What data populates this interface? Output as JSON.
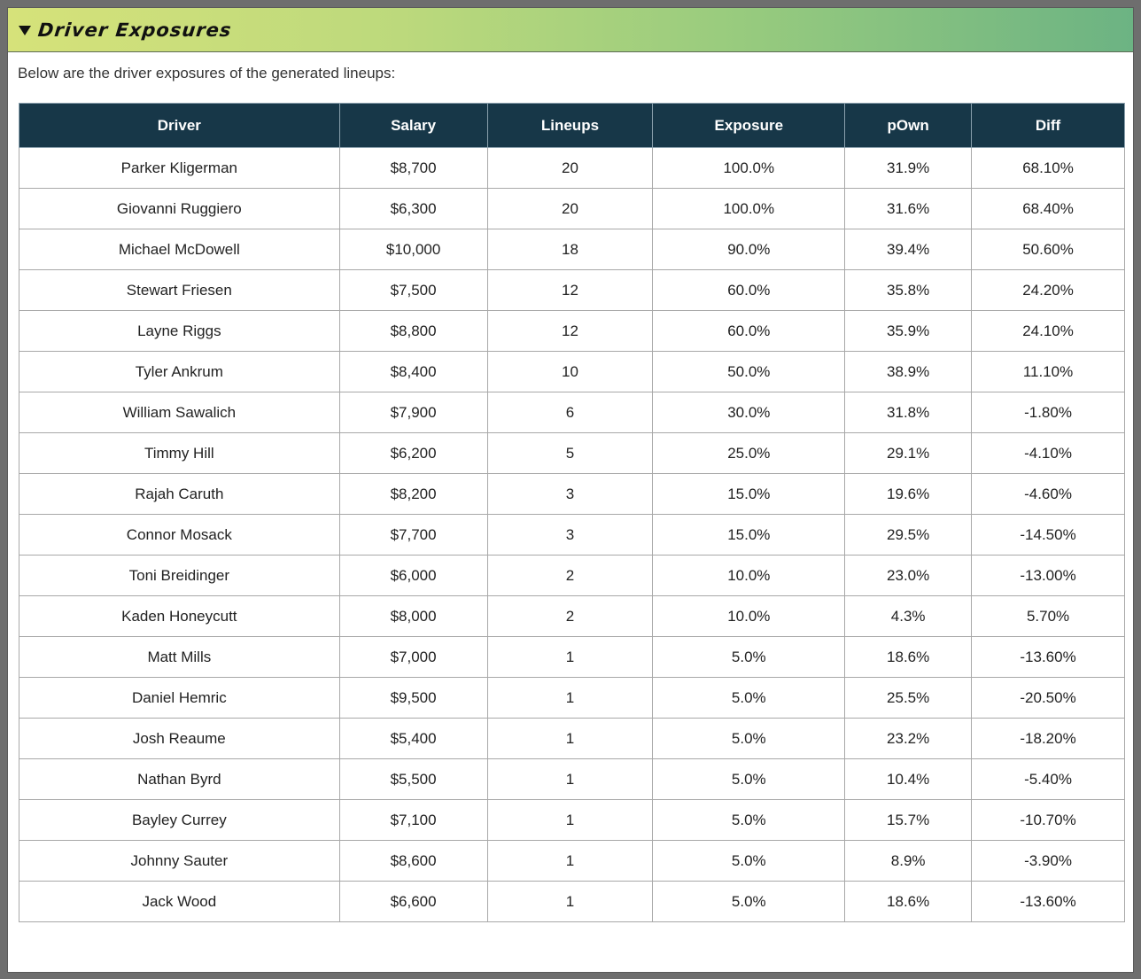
{
  "panel": {
    "title": "Driver Exposures",
    "intro": "Below are the driver exposures of the generated lineups:"
  },
  "table": {
    "columns": [
      "Driver",
      "Salary",
      "Lineups",
      "Exposure",
      "pOwn",
      "Diff"
    ],
    "rows": [
      [
        "Parker Kligerman",
        "$8,700",
        "20",
        "100.0%",
        "31.9%",
        "68.10%"
      ],
      [
        "Giovanni Ruggiero",
        "$6,300",
        "20",
        "100.0%",
        "31.6%",
        "68.40%"
      ],
      [
        "Michael McDowell",
        "$10,000",
        "18",
        "90.0%",
        "39.4%",
        "50.60%"
      ],
      [
        "Stewart Friesen",
        "$7,500",
        "12",
        "60.0%",
        "35.8%",
        "24.20%"
      ],
      [
        "Layne Riggs",
        "$8,800",
        "12",
        "60.0%",
        "35.9%",
        "24.10%"
      ],
      [
        "Tyler Ankrum",
        "$8,400",
        "10",
        "50.0%",
        "38.9%",
        "11.10%"
      ],
      [
        "William Sawalich",
        "$7,900",
        "6",
        "30.0%",
        "31.8%",
        "-1.80%"
      ],
      [
        "Timmy Hill",
        "$6,200",
        "5",
        "25.0%",
        "29.1%",
        "-4.10%"
      ],
      [
        "Rajah Caruth",
        "$8,200",
        "3",
        "15.0%",
        "19.6%",
        "-4.60%"
      ],
      [
        "Connor Mosack",
        "$7,700",
        "3",
        "15.0%",
        "29.5%",
        "-14.50%"
      ],
      [
        "Toni Breidinger",
        "$6,000",
        "2",
        "10.0%",
        "23.0%",
        "-13.00%"
      ],
      [
        "Kaden Honeycutt",
        "$8,000",
        "2",
        "10.0%",
        "4.3%",
        "5.70%"
      ],
      [
        "Matt Mills",
        "$7,000",
        "1",
        "5.0%",
        "18.6%",
        "-13.60%"
      ],
      [
        "Daniel Hemric",
        "$9,500",
        "1",
        "5.0%",
        "25.5%",
        "-20.50%"
      ],
      [
        "Josh Reaume",
        "$5,400",
        "1",
        "5.0%",
        "23.2%",
        "-18.20%"
      ],
      [
        "Nathan Byrd",
        "$5,500",
        "1",
        "5.0%",
        "10.4%",
        "-5.40%"
      ],
      [
        "Bayley Currey",
        "$7,100",
        "1",
        "5.0%",
        "15.7%",
        "-10.70%"
      ],
      [
        "Johnny Sauter",
        "$8,600",
        "1",
        "5.0%",
        "8.9%",
        "-3.90%"
      ],
      [
        "Jack Wood",
        "$6,600",
        "1",
        "5.0%",
        "18.6%",
        "-13.60%"
      ]
    ]
  },
  "colors": {
    "header_bg": "#173748",
    "gradient_start": "#d6e27a",
    "gradient_end": "#6cb383"
  },
  "icons": {
    "collapse": "caret-down-icon"
  }
}
